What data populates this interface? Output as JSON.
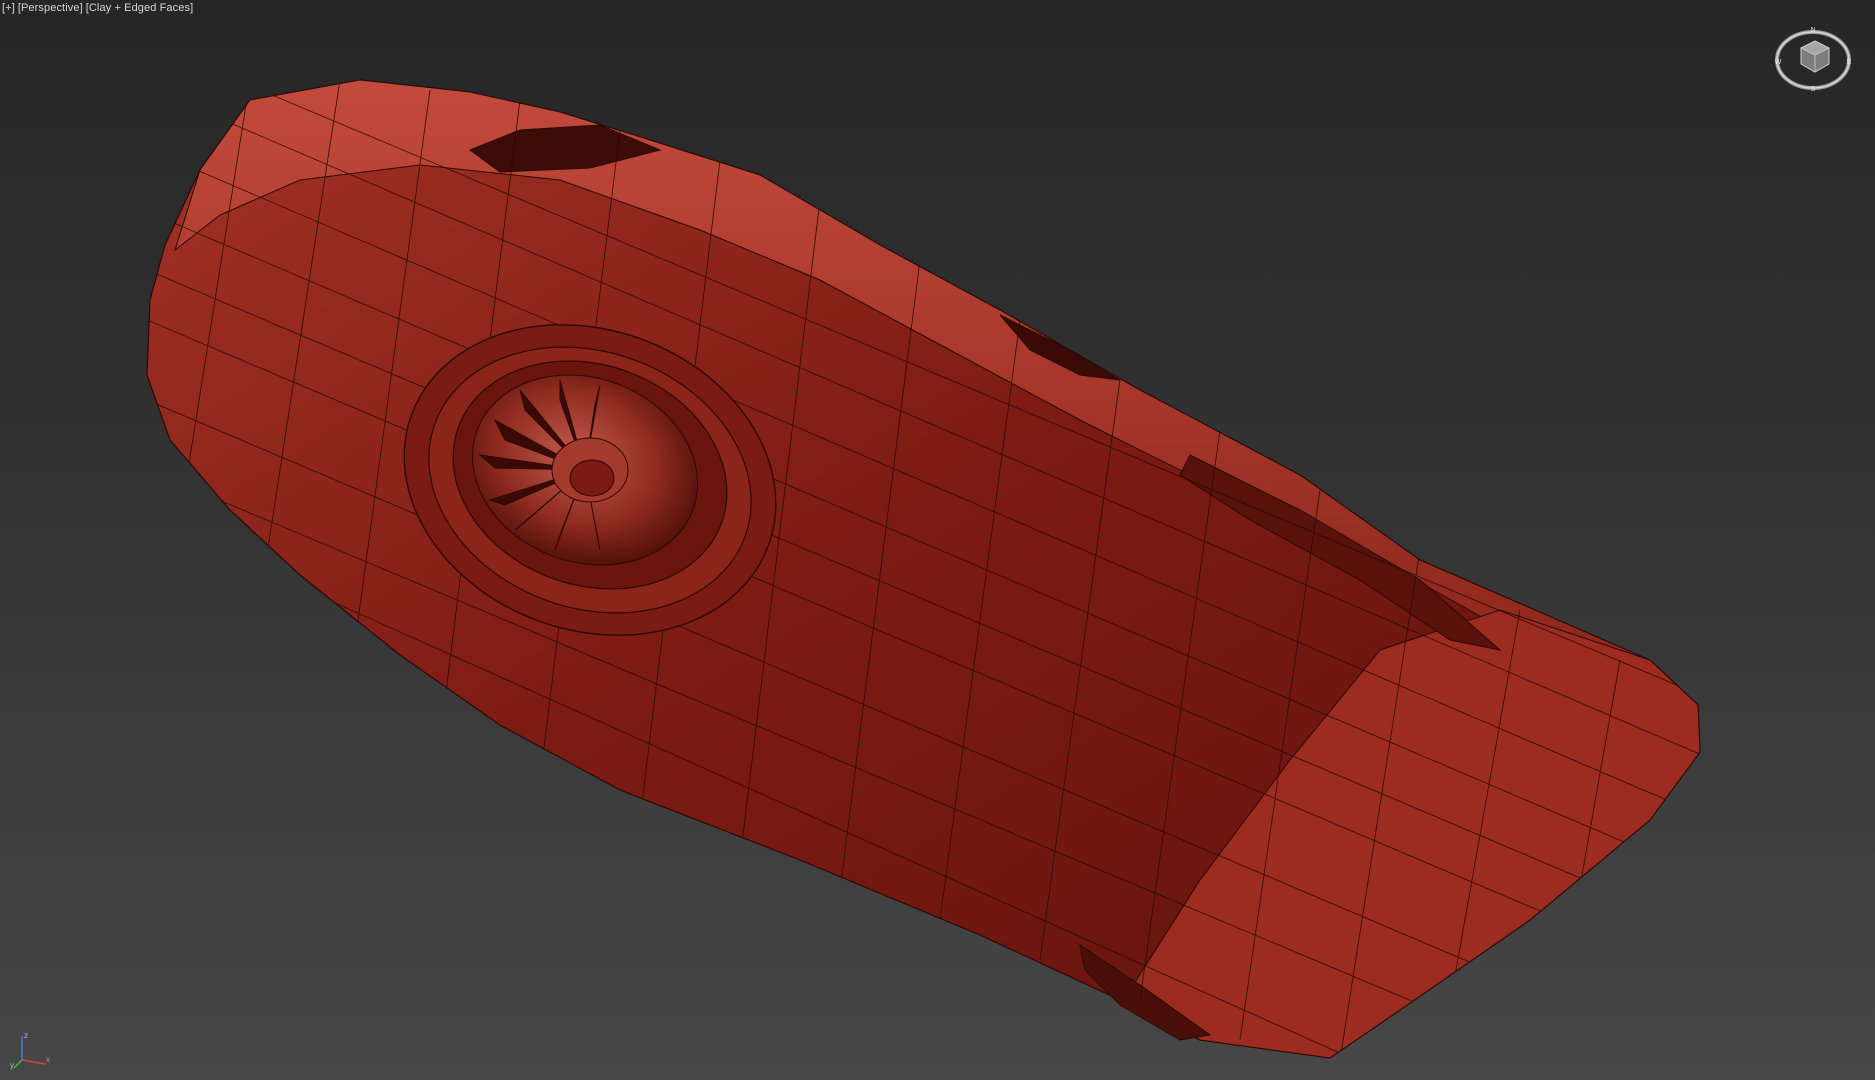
{
  "viewport": {
    "labels": [
      {
        "id": "plus",
        "text": "+"
      },
      {
        "id": "view",
        "text": "Perspective"
      },
      {
        "id": "shading",
        "text": "Clay + Edged Faces"
      }
    ]
  },
  "viewcube": {
    "compass": [
      "N",
      "E",
      "S",
      "W"
    ],
    "icon": "viewcube-icon"
  },
  "axis_tripod": {
    "icon": "axis-tripod-icon",
    "axes": [
      "x",
      "y",
      "z"
    ],
    "colors": {
      "x": "#d84040",
      "y": "#3fbf3f",
      "z": "#4a7fe0"
    }
  },
  "scene": {
    "object": "clay-mesh-model",
    "clay_color": "#8a2219",
    "edge_color": "#2a0a06",
    "background_top": "#262626",
    "background_bottom": "#474747"
  }
}
